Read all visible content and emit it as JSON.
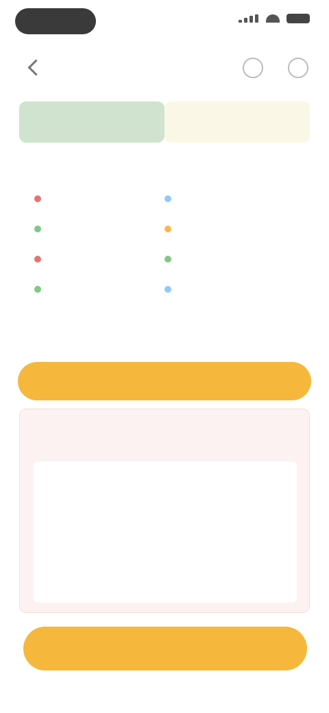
{
  "header": {
    "title": "",
    "back_icon": "back-arrow-icon",
    "more_icon": "more-icon",
    "target_icon": "target-icon"
  },
  "tabs": [
    {
      "label": "",
      "active": true
    },
    {
      "label": "",
      "active": false
    }
  ],
  "legend": {
    "title": "",
    "items": [
      {
        "label": "",
        "color": "#e57373"
      },
      {
        "label": "",
        "color": "#90caf9"
      },
      {
        "label": "",
        "color": "#81c784"
      },
      {
        "label": "",
        "color": "#ffb74d"
      },
      {
        "label": "",
        "color": "#e57373"
      },
      {
        "label": "",
        "color": "#81c784"
      },
      {
        "label": "",
        "color": "#81c784"
      },
      {
        "label": "",
        "color": "#90caf9"
      }
    ]
  },
  "buttons": {
    "primary_label": "",
    "secondary_label": ""
  },
  "card": {
    "title": "",
    "lines": [
      "",
      "",
      "",
      "",
      ""
    ]
  },
  "footer": {
    "text": ""
  },
  "colors": {
    "accent": "#f5b83c",
    "tab_active_bg": "#cfe3cf",
    "tab_inactive_bg": "#fbf7e6",
    "card_bg": "#fdf2f2"
  }
}
